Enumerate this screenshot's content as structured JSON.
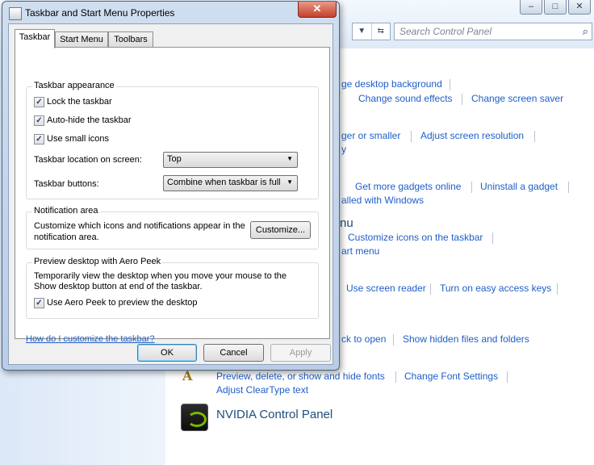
{
  "dialog": {
    "title": "Taskbar and Start Menu Properties",
    "close_label": "✕",
    "tabs": [
      "Taskbar",
      "Start Menu",
      "Toolbars"
    ],
    "active_tab": "Taskbar",
    "appearance": {
      "title": "Taskbar appearance",
      "lock_label": "Lock the taskbar",
      "lock_checked": true,
      "autohide_label": "Auto-hide the taskbar",
      "autohide_checked": true,
      "small_icons_label": "Use small icons",
      "small_icons_checked": true,
      "location_label": "Taskbar location on screen:",
      "location_value": "Top",
      "buttons_label": "Taskbar buttons:",
      "buttons_value": "Combine when taskbar is full"
    },
    "notification": {
      "title": "Notification area",
      "text_line1": "Customize which icons and notifications appear in the",
      "text_line2": "notification area.",
      "customize_label": "Customize..."
    },
    "aero_peek": {
      "title": "Preview desktop with Aero Peek",
      "text_line1": "Temporarily view the desktop when you move your mouse to the",
      "text_line2": "Show desktop button at end of the taskbar.",
      "checkbox_label": "Use Aero Peek to preview the desktop",
      "checked": true
    },
    "help_link": "How do I customize the taskbar?",
    "ok_label": "OK",
    "cancel_label": "Cancel",
    "apply_label": "Apply"
  },
  "control_panel": {
    "search_placeholder": "Search Control Panel",
    "links": {
      "desktop_bg": "ge desktop background",
      "sound_effects": "Change sound effects",
      "screen_saver": "Change screen saver",
      "larger_smaller": "ger or smaller",
      "resolution": "Adjust screen resolution",
      "y": "y",
      "gadgets_online": "Get more gadgets online",
      "uninstall_gadget": "Uninstall a gadget",
      "installed_windows": "alled with Windows",
      "nu": "nu",
      "customize_icons": "Customize icons on the taskbar",
      "art_menu": "art menu",
      "screen_reader": "Use screen reader",
      "access_keys": "Turn on easy access keys",
      "ck_open": "ck to open",
      "hidden_files": "Show hidden files and folders",
      "fonts": "Preview, delete, or show and hide fonts",
      "font_settings": "Change Font Settings",
      "cleartype": "Adjust ClearType text",
      "nvidia": "NVIDIA Control Panel"
    }
  }
}
